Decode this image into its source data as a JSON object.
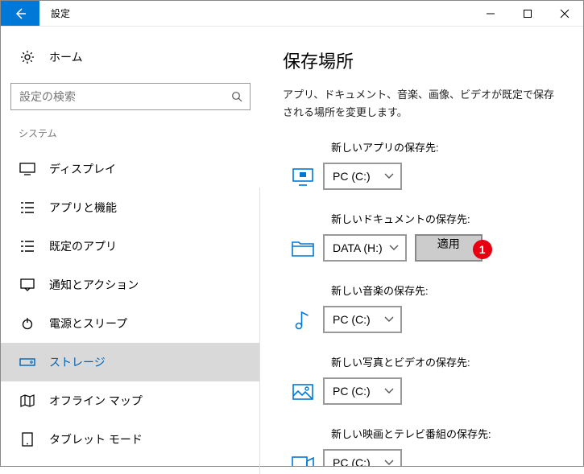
{
  "window": {
    "title": "設定"
  },
  "sidebar": {
    "home_label": "ホーム",
    "search_placeholder": "設定の検索",
    "section_label": "システム",
    "items": [
      {
        "label": "ディスプレイ"
      },
      {
        "label": "アプリと機能"
      },
      {
        "label": "既定のアプリ"
      },
      {
        "label": "通知とアクション"
      },
      {
        "label": "電源とスリープ"
      },
      {
        "label": "ストレージ"
      },
      {
        "label": "オフライン マップ"
      },
      {
        "label": "タブレット モード"
      }
    ]
  },
  "main": {
    "title": "保存場所",
    "description": "アプリ、ドキュメント、音楽、画像、ビデオが既定で保存される場所を変更します。",
    "settings": [
      {
        "label": "新しいアプリの保存先:",
        "value": "PC (C:)"
      },
      {
        "label": "新しいドキュメントの保存先:",
        "value": "DATA (H:)",
        "apply_label": "適用",
        "badge": "1"
      },
      {
        "label": "新しい音楽の保存先:",
        "value": "PC (C:)"
      },
      {
        "label": "新しい写真とビデオの保存先:",
        "value": "PC (C:)"
      },
      {
        "label": "新しい映画とテレビ番組の保存先:",
        "value": "PC (C:)"
      }
    ]
  }
}
